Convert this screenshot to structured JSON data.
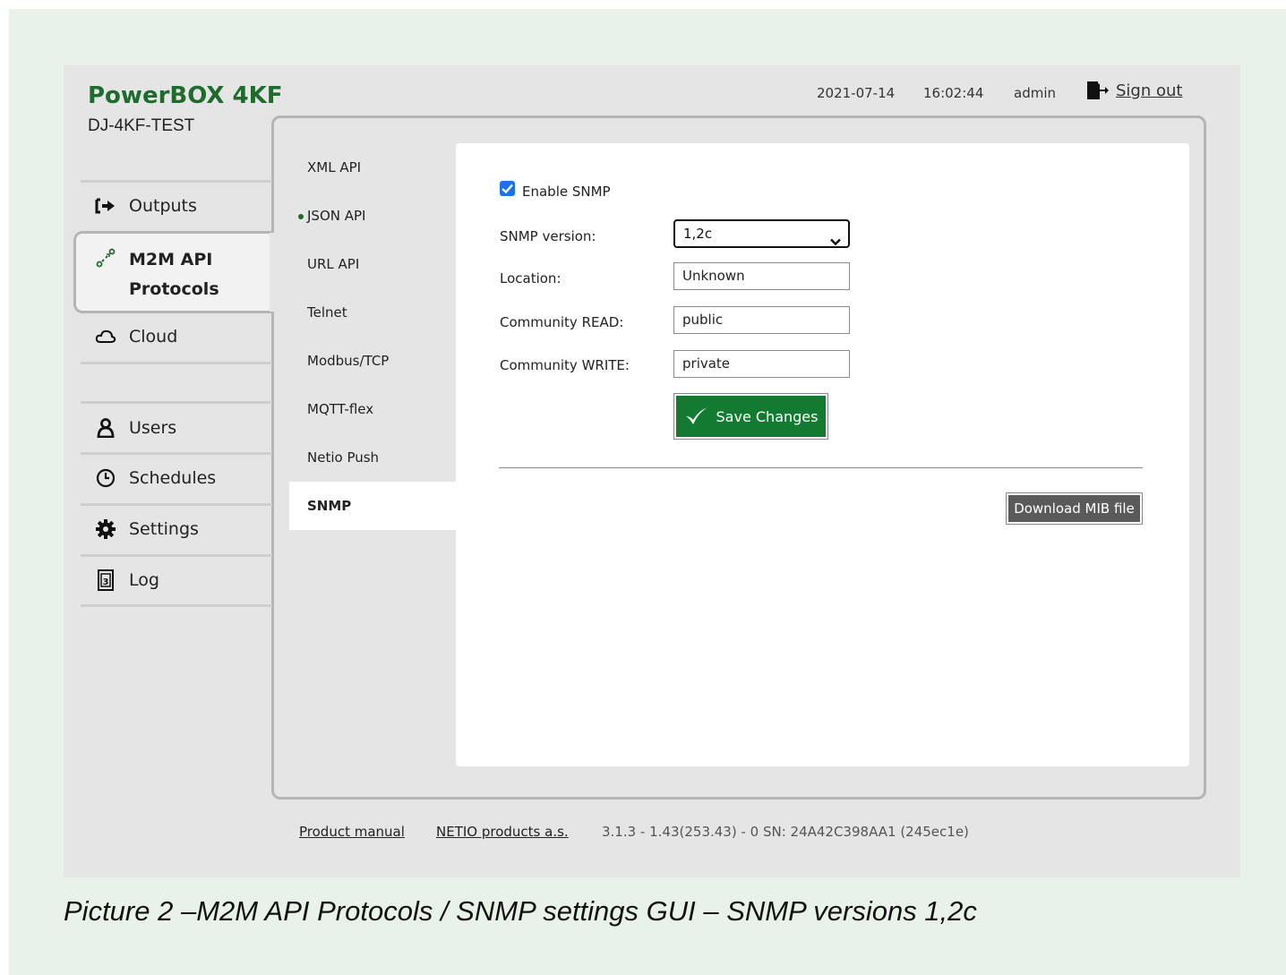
{
  "app": {
    "brand": "PowerBOX 4KF",
    "device_name": "DJ-4KF-TEST",
    "date": "2021-07-14",
    "time": "16:02:44",
    "user": "admin",
    "sign_out": "Sign out"
  },
  "sidebar": {
    "items": [
      {
        "label": "Outputs",
        "icon": "arrow-right-bracket-icon"
      },
      {
        "label": "M2M API",
        "label2": "Protocols",
        "icon": "network-nodes-icon",
        "active": true
      },
      {
        "label": "Cloud",
        "icon": "cloud-icon"
      },
      {
        "label": "Users",
        "icon": "user-icon"
      },
      {
        "label": "Schedules",
        "icon": "clock-icon"
      },
      {
        "label": "Settings",
        "icon": "gear-icon"
      },
      {
        "label": "Log",
        "icon": "log-icon"
      }
    ]
  },
  "subnav": {
    "items": [
      "XML API",
      "JSON API",
      "URL API",
      "Telnet",
      "Modbus/TCP",
      "MQTT-flex",
      "Netio Push",
      "SNMP"
    ],
    "active": "SNMP",
    "enabled_marker": "JSON API"
  },
  "form": {
    "enable_label": "Enable SNMP",
    "enable_checked": true,
    "version_label": "SNMP version:",
    "version_value": "1,2c",
    "location_label": "Location:",
    "location_value": "Unknown",
    "read_label": "Community READ:",
    "read_value": "public",
    "write_label": "Community WRITE:",
    "write_value": "private",
    "save_label": "Save Changes",
    "mib_label": "Download MIB file"
  },
  "footer": {
    "manual": "Product manual",
    "company": "NETIO products a.s.",
    "version": "3.1.3 - 1.43(253.43) - 0 SN: 24A42C398AA1 (245ec1e)"
  },
  "caption": "Picture 2 –M2M API Protocols / SNMP settings GUI – SNMP versions 1,2c",
  "colors": {
    "brand": "#1e6b2e",
    "save": "#137a32",
    "page_bg": "#e9f2e9",
    "app_bg": "#e5e5e5"
  }
}
